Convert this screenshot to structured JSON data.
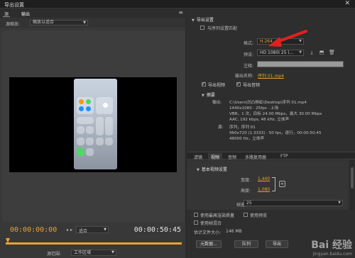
{
  "window": {
    "title": "导出设置",
    "close_glyph": "✕"
  },
  "left": {
    "tabs": [
      {
        "label": "源"
      },
      {
        "label": "输出"
      }
    ],
    "source_scaling_label": "源缩放:",
    "source_scaling_value": "缩放以适合",
    "current_time": "00:00:00:00",
    "duration": "00:00:50:45",
    "fit_label": "适合",
    "range_label": "源范围:",
    "range_value": "工作区域"
  },
  "right": {
    "export_settings_header": "导出设置",
    "match_sequence_label": "与序列设置匹配",
    "format_label": "格式:",
    "format_value": "H.264",
    "preset_label": "预设:",
    "preset_value": "HD 1080i 25 (...",
    "comments_label": "注释:",
    "output_name_label": "输出名称:",
    "output_name_value": "序列 01.mp4",
    "export_video_label": "导出视频",
    "export_audio_label": "导出音频",
    "summary_header": "摘要",
    "summary": {
      "output_label": "输出:",
      "output_lines": [
        "C:\\Users\\凹凸杨虹\\Desktop\\序列 01.mp4",
        "1440x1080 · 25fps · 上场",
        "VBR，1 次，目标 24.00 Mbps，最大 30.00 Mbps",
        "AAC, 192 kbps, 48 kHz, 立体声"
      ],
      "source_label": "源:",
      "source_lines": [
        "序列，序列 01",
        "960x720 (1.3333) · 50 fps，逐行，00:00:50:45",
        "48000 Hz，立体声"
      ]
    },
    "tabs": [
      {
        "label": "滤镜"
      },
      {
        "label": "视频"
      },
      {
        "label": "音频"
      },
      {
        "label": "多路复用器"
      },
      {
        "label": "FTP"
      }
    ],
    "basic_video_header": "基本视频设置",
    "width_label": "宽度:",
    "width_value": "1,440",
    "height_label": "高度:",
    "height_value": "1,080",
    "frame_rate_label": "帧速率:",
    "frame_rate_value": "25",
    "max_render_label": "使用最高渲染质量",
    "use_preview_label": "使用预览",
    "frame_blend_label": "使用帧混合",
    "estimated_size_label": "估计文件大小:",
    "estimated_size_value": "146 MB",
    "metadata_button": "元数据...",
    "queue_button": "队列",
    "export_button": "导出"
  },
  "watermark": {
    "text": "Bai 经验",
    "sub": "jingyan.baidu.com"
  },
  "colors": {
    "accent_orange": "#e8a230",
    "annotation_red": "#e02020",
    "panel": "#2e2e2e"
  },
  "icons": [
    "close-icon",
    "save-preset-icon",
    "import-preset-icon",
    "delete-preset-icon",
    "chain-link-icon",
    "collapse-triangle-icon"
  ]
}
